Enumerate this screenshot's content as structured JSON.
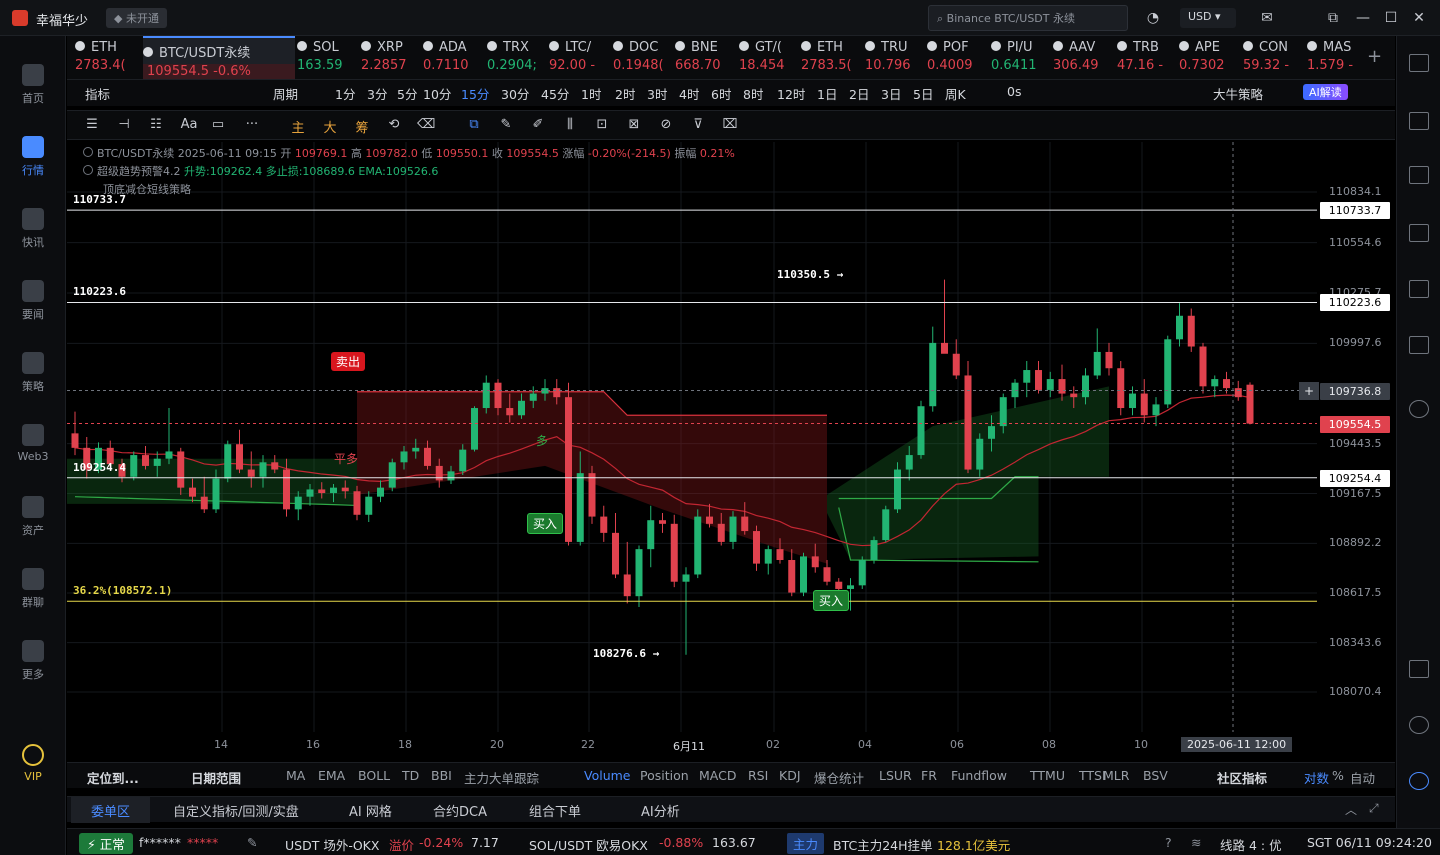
{
  "app": {
    "name": "幸福华少",
    "status": "未开通",
    "search_placeholder": "Binance BTC/USDT 永续",
    "currency": "USD"
  },
  "sidebar": [
    {
      "label": "首页"
    },
    {
      "label": "行情",
      "active": true
    },
    {
      "label": "快讯"
    },
    {
      "label": "要闻"
    },
    {
      "label": "策略"
    },
    {
      "label": "Web3"
    },
    {
      "label": "资产"
    },
    {
      "label": "群聊"
    },
    {
      "label": "更多"
    },
    {
      "label": "VIP"
    }
  ],
  "tickers": [
    {
      "name": "ETH",
      "price": "2783.4("
    },
    {
      "name": "BTC/USDT永续",
      "price": "109554.5  -0.6%",
      "active": true
    },
    {
      "name": "SOL",
      "price": "163.59"
    },
    {
      "name": "XRP",
      "price": "2.2857"
    },
    {
      "name": "ADA",
      "price": "0.7110"
    },
    {
      "name": "TRX",
      "price": "0.2904;"
    },
    {
      "name": "LTC/",
      "price": "92.00 -"
    },
    {
      "name": "DOC",
      "price": "0.1948("
    },
    {
      "name": "BNE",
      "price": "668.70"
    },
    {
      "name": "GT/(",
      "price": "18.454"
    },
    {
      "name": "ETH",
      "price": "2783.5("
    },
    {
      "name": "TRU",
      "price": "10.796"
    },
    {
      "name": "POF",
      "price": "0.4009"
    },
    {
      "name": "PI/U",
      "price": "0.6411"
    },
    {
      "name": "AAV",
      "price": "306.49"
    },
    {
      "name": "TRB",
      "price": "47.16 -"
    },
    {
      "name": "APE",
      "price": "0.7302"
    },
    {
      "name": "CON",
      "price": "59.32 -"
    },
    {
      "name": "MAS",
      "price": "1.579 -"
    }
  ],
  "ticker_colors": [
    "red",
    "red",
    "green",
    "red",
    "red",
    "green",
    "red",
    "red",
    "red",
    "red",
    "red",
    "red",
    "red",
    "green",
    "red",
    "red",
    "red",
    "red",
    "red"
  ],
  "periods": [
    "指标",
    "周期",
    "1分",
    "3分",
    "5分",
    "10分",
    "15分",
    "30分",
    "45分",
    "1时",
    "2时",
    "3时",
    "4时",
    "6时",
    "8时",
    "12时",
    "1日",
    "2日",
    "3日",
    "5日",
    "周K",
    "0s",
    "大牛策略",
    "AI解读"
  ],
  "toolbar_labels": [
    "Aa",
    "主",
    "大",
    "筹"
  ],
  "chart_header": {
    "line1": "BTC/USDT永续  2025-06-11 09:15  开",
    "open": "109769.1",
    "high_l": "高",
    "high": "109782.0",
    "low_l": "低",
    "low": "109550.1",
    "close_l": "收",
    "close": "109554.5",
    "chg_l": "涨幅",
    "chg": "-0.20%(-214.5)",
    "amp_l": "振幅",
    "amp": "0.21%",
    "line2": "超级趋势预警4.2",
    "up": "升势:109262.4",
    "sl": "多止损:108689.6",
    "ema": "EMA:109526.6",
    "line3": "顶底减仓短线策略"
  },
  "chart_data": {
    "type": "candlestick",
    "y_axis": [
      "110834.1",
      "110554.6",
      "110275.7",
      "109997.6",
      "109443.5",
      "109167.5",
      "108892.2",
      "108617.5",
      "108343.6",
      "108070.4"
    ],
    "x_axis": [
      "14",
      "16",
      "18",
      "20",
      "22",
      "6月11",
      "02",
      "04",
      "06",
      "08",
      "10"
    ],
    "crosshair_date": "2025-06-11 12:00",
    "horizontal_levels": [
      {
        "label": "110733.7",
        "value": 110733.7
      },
      {
        "label": "110223.6",
        "value": 110223.6
      },
      {
        "label": "109254.4",
        "value": 109254.4
      },
      {
        "label": "36.2%(108572.1)",
        "value": 108572.1
      }
    ],
    "current_price": "109554.5",
    "crosshair_price": "109736.8",
    "annotations": [
      {
        "text": "110350.5 →"
      },
      {
        "text": "108276.6 →"
      }
    ],
    "signals": [
      {
        "text": "卖出",
        "type": "sell"
      },
      {
        "text": "平多",
        "type": "close"
      },
      {
        "text": "买入",
        "type": "buy"
      },
      {
        "text": "买入",
        "type": "buy"
      },
      {
        "text": "多",
        "type": "long"
      }
    ],
    "candles": [
      [
        109500,
        109620,
        109380,
        109420
      ],
      [
        109420,
        109480,
        109250,
        109300
      ],
      [
        109300,
        109450,
        109280,
        109420
      ],
      [
        109420,
        109460,
        109300,
        109330
      ],
      [
        109330,
        109360,
        109230,
        109260
      ],
      [
        109260,
        109400,
        109240,
        109380
      ],
      [
        109380,
        109430,
        109300,
        109320
      ],
      [
        109320,
        109400,
        109260,
        109360
      ],
      [
        109360,
        109640,
        109330,
        109400
      ],
      [
        109400,
        109420,
        109160,
        109200
      ],
      [
        109200,
        109250,
        109120,
        109150
      ],
      [
        109150,
        109260,
        109060,
        109080
      ],
      [
        109080,
        109300,
        109060,
        109250
      ],
      [
        109250,
        109460,
        109230,
        109440
      ],
      [
        109440,
        109520,
        109280,
        109300
      ],
      [
        109300,
        109400,
        109200,
        109260
      ],
      [
        109260,
        109380,
        109200,
        109340
      ],
      [
        109340,
        109380,
        109280,
        109300
      ],
      [
        109300,
        109360,
        109040,
        109080
      ],
      [
        109080,
        109180,
        109020,
        109150
      ],
      [
        109150,
        109220,
        109100,
        109190
      ],
      [
        109190,
        109230,
        109140,
        109170
      ],
      [
        109170,
        109220,
        109120,
        109200
      ],
      [
        109200,
        109240,
        109140,
        109180
      ],
      [
        109180,
        109210,
        109020,
        109050
      ],
      [
        109050,
        109180,
        109010,
        109150
      ],
      [
        109150,
        109240,
        109120,
        109200
      ],
      [
        109200,
        109360,
        109180,
        109340
      ],
      [
        109340,
        109430,
        109300,
        109400
      ],
      [
        109400,
        109470,
        109360,
        109420
      ],
      [
        109420,
        109460,
        109300,
        109320
      ],
      [
        109320,
        109360,
        109200,
        109240
      ],
      [
        109240,
        109320,
        109220,
        109290
      ],
      [
        109290,
        109440,
        109270,
        109410
      ],
      [
        109410,
        109650,
        109400,
        109640
      ],
      [
        109640,
        109820,
        109610,
        109780
      ],
      [
        109780,
        109800,
        109600,
        109640
      ],
      [
        109640,
        109720,
        109560,
        109600
      ],
      [
        109600,
        109720,
        109580,
        109680
      ],
      [
        109680,
        109760,
        109640,
        109720
      ],
      [
        109720,
        109800,
        109680,
        109750
      ],
      [
        109750,
        109800,
        109660,
        109700
      ],
      [
        109700,
        109780,
        108880,
        108900
      ],
      [
        108900,
        109400,
        108880,
        109280
      ],
      [
        109280,
        109320,
        109000,
        109040
      ],
      [
        109040,
        109100,
        108900,
        108950
      ],
      [
        108950,
        109060,
        108700,
        108720
      ],
      [
        108720,
        108900,
        108560,
        108600
      ],
      [
        108600,
        108880,
        108540,
        108860
      ],
      [
        108860,
        109100,
        108760,
        109020
      ],
      [
        109020,
        109060,
        108950,
        109000
      ],
      [
        109000,
        109050,
        108650,
        108680
      ],
      [
        108680,
        108760,
        108276,
        108720
      ],
      [
        108720,
        109080,
        108700,
        109040
      ],
      [
        109040,
        109110,
        108980,
        109000
      ],
      [
        109000,
        109060,
        108880,
        108900
      ],
      [
        108900,
        109070,
        108860,
        109040
      ],
      [
        109040,
        109120,
        108940,
        108960
      ],
      [
        108960,
        108990,
        108740,
        108780
      ],
      [
        108780,
        108880,
        108720,
        108860
      ],
      [
        108860,
        108920,
        108780,
        108800
      ],
      [
        108800,
        108860,
        108600,
        108620
      ],
      [
        108620,
        108840,
        108600,
        108820
      ],
      [
        108820,
        108890,
        108730,
        108760
      ],
      [
        108760,
        108800,
        108660,
        108680
      ],
      [
        108680,
        108700,
        108580,
        108640
      ],
      [
        108640,
        108700,
        108520,
        108660
      ],
      [
        108660,
        108820,
        108640,
        108800
      ],
      [
        108800,
        108930,
        108780,
        108910
      ],
      [
        108910,
        109100,
        108900,
        109080
      ],
      [
        109080,
        109340,
        109060,
        109300
      ],
      [
        109300,
        109430,
        109240,
        109380
      ],
      [
        109380,
        109680,
        109360,
        109650
      ],
      [
        109650,
        110090,
        109620,
        110000
      ],
      [
        110000,
        110350,
        109950,
        109940
      ],
      [
        109940,
        110020,
        109800,
        109820
      ],
      [
        109820,
        109900,
        109280,
        109300
      ],
      [
        109300,
        109500,
        109260,
        109470
      ],
      [
        109470,
        109600,
        109400,
        109540
      ],
      [
        109540,
        109720,
        109500,
        109700
      ],
      [
        109700,
        109800,
        109640,
        109780
      ],
      [
        109780,
        109900,
        109700,
        109850
      ],
      [
        109850,
        109900,
        109720,
        109740
      ],
      [
        109740,
        109840,
        109700,
        109800
      ],
      [
        109800,
        109880,
        109680,
        109720
      ],
      [
        109720,
        109760,
        109640,
        109700
      ],
      [
        109700,
        109860,
        109660,
        109820
      ],
      [
        109820,
        110080,
        109800,
        109950
      ],
      [
        109950,
        110000,
        109820,
        109860
      ],
      [
        109860,
        109900,
        109600,
        109640
      ],
      [
        109640,
        109760,
        109600,
        109720
      ],
      [
        109720,
        109800,
        109560,
        109600
      ],
      [
        109600,
        109700,
        109540,
        109660
      ],
      [
        109660,
        110040,
        109640,
        110020
      ],
      [
        110020,
        110220,
        109980,
        110150
      ],
      [
        110150,
        110190,
        109950,
        109980
      ],
      [
        109980,
        110000,
        109720,
        109760
      ],
      [
        109760,
        109820,
        109700,
        109800
      ],
      [
        109800,
        109840,
        109720,
        109750
      ],
      [
        109750,
        109790,
        109680,
        109700
      ],
      [
        109769,
        109782,
        109550,
        109554
      ]
    ]
  },
  "indicators": [
    "定位到...",
    "日期范围",
    "MA",
    "EMA",
    "BOLL",
    "TD",
    "BBI",
    "主力大单跟踪",
    "Volume",
    "Position",
    "MACD",
    "RSI",
    "KDJ",
    "爆仓统计",
    "LSUR",
    "FR",
    "Fundflow",
    "TTMU",
    "TTSI",
    "MLR",
    "BSV",
    "社区指标",
    "对数",
    "%",
    "自动"
  ],
  "panels": [
    "委单区",
    "自定义指标/回测/实盘",
    "AI 网格",
    "合约DCA",
    "组合下单",
    "AI分析"
  ],
  "status": {
    "conn": "正常",
    "user": "f******",
    "pwd": "*****",
    "usdt": "USDT 场外-OKX",
    "premium_l": "溢价",
    "premium": "-0.24%",
    "premium_v": "7.17",
    "sol": "SOL/USDT 欧易OKX",
    "sol_chg": "-0.88%",
    "sol_price": "163.67",
    "main": "主力",
    "btc_main": "BTC主力24H挂单",
    "btc_val": "128.1亿美元",
    "line": "线路 4 : 优",
    "time": "SGT 06/11 09:24:20"
  },
  "colors": {
    "up": "#22b573",
    "down": "#e0424e",
    "accent": "#4a8bff",
    "bg": "#000000"
  }
}
